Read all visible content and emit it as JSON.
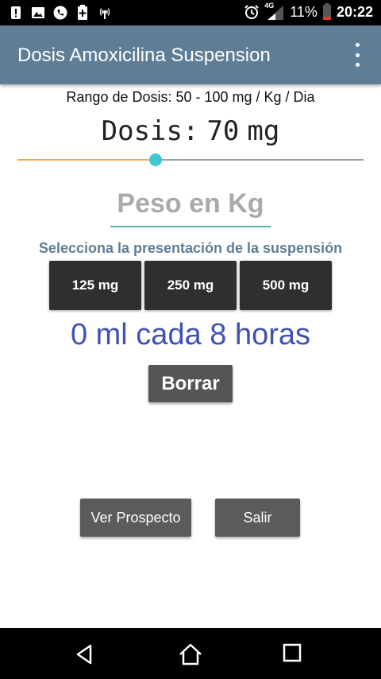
{
  "status_bar": {
    "icons_left": [
      "alert-icon",
      "image-icon",
      "phone-icon",
      "battery-saver-icon",
      "wireless-icon"
    ],
    "network": "4G",
    "battery": "11%",
    "time": "20:22"
  },
  "app_bar": {
    "title": "Dosis Amoxicilina Suspension",
    "menu_icon": "overflow-menu-icon"
  },
  "dose_range": "Rango de Dosis: 50 - 100 mg / Kg / Dia",
  "dose": {
    "label": "Dosis:",
    "value": "70",
    "unit": "mg"
  },
  "slider": {
    "min": 50,
    "max": 100,
    "value": 70,
    "active_color": "#f4a84a",
    "thumb_color": "#3fc8d4"
  },
  "weight_input": {
    "placeholder": "Peso en Kg",
    "value": ""
  },
  "presentation": {
    "heading": "Selecciona la presentación de la suspensión",
    "options": [
      "125 mg",
      "250 mg",
      "500 mg"
    ]
  },
  "result": {
    "ml": "0",
    "text": "ml cada 8 horas"
  },
  "buttons": {
    "clear": "Borrar",
    "leaflet": "Ver Prospecto",
    "exit": "Salir"
  },
  "nav": {
    "back": "back-icon",
    "home": "home-icon",
    "recents": "recents-icon"
  },
  "colors": {
    "app_bar": "#5f7d95",
    "accent_text": "#3f51b5",
    "input_underline": "#4db6ac"
  }
}
